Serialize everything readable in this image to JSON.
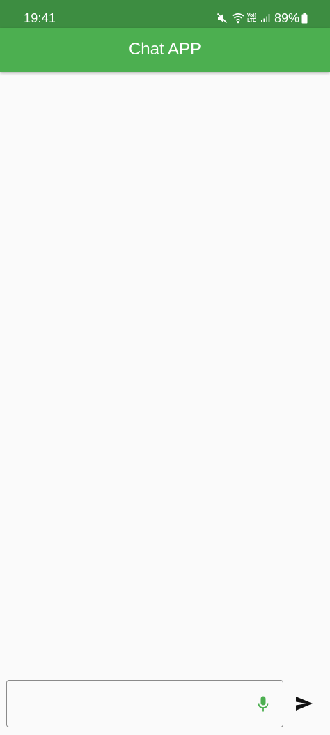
{
  "status_bar": {
    "time": "19:41",
    "battery_percent": "89%",
    "lte_top": "Vo))",
    "lte_bottom": "LTE",
    "icons": [
      "mute-icon",
      "wifi-icon",
      "volte-icon",
      "signal-icon",
      "battery-icon"
    ]
  },
  "app_bar": {
    "title": "Chat APP"
  },
  "messages": [],
  "composer": {
    "input_value": "",
    "placeholder": "",
    "mic_icon": "mic-icon",
    "send_icon": "send-icon"
  },
  "colors": {
    "status_bar": "#3d8d41",
    "app_bar": "#4caf50",
    "background": "#fafafa",
    "mic_accent": "#4caf50",
    "send_icon": "#111111"
  }
}
